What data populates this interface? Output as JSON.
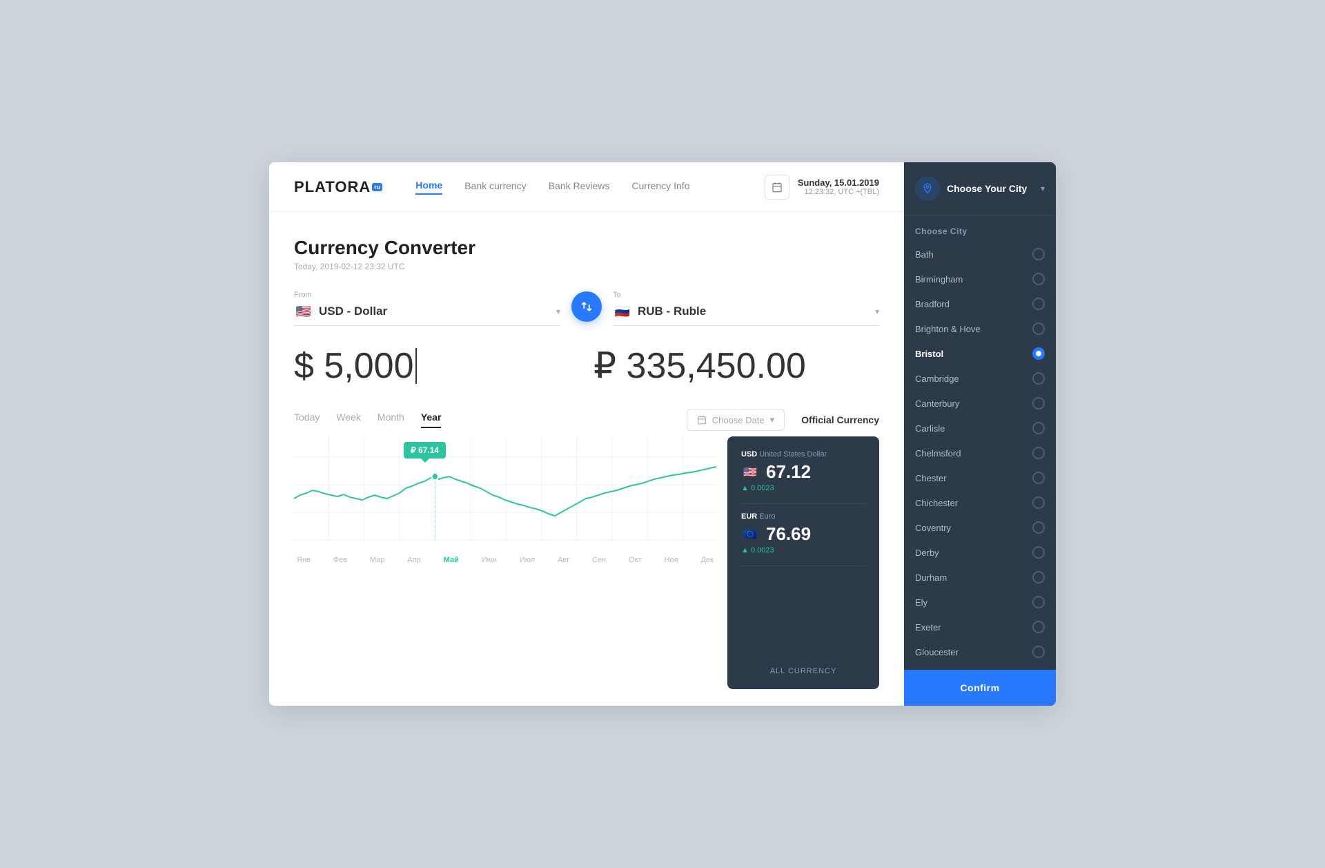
{
  "header": {
    "logo_text": "PLATORA",
    "logo_badge": "ru",
    "nav_items": [
      {
        "label": "Home",
        "active": true
      },
      {
        "label": "Bank currency",
        "active": false
      },
      {
        "label": "Bank Reviews",
        "active": false
      },
      {
        "label": "Currency Info",
        "active": false
      }
    ],
    "date_main": "Sunday, 15.01.2019",
    "date_sub": "12:23:32, UTC +(TBL)"
  },
  "page": {
    "title": "Currency Converter",
    "subtitle": "Today, 2019-02-12 23:32 UTC"
  },
  "converter": {
    "from_label": "From",
    "from_currency": "USD - Dollar",
    "from_flag": "🇺🇸",
    "to_label": "To",
    "to_currency": "RUB - Ruble",
    "to_flag": "🇷🇺",
    "from_amount": "$ 5,000",
    "to_amount": "₽ 335,450.00"
  },
  "time_range": {
    "buttons": [
      "Today",
      "Week",
      "Month",
      "Year"
    ],
    "active": "Year",
    "date_picker_placeholder": "Choose Date"
  },
  "chart": {
    "tooltip": "₽ 67.14",
    "x_labels": [
      "Янв",
      "Фев",
      "Мар",
      "Апр",
      "Май",
      "Июн",
      "Июл",
      "Авг",
      "Сен",
      "Окт",
      "Ноя",
      "Дек"
    ],
    "active_label": "Май"
  },
  "official_currency": {
    "label": "Official Currency",
    "entries": [
      {
        "code": "USD",
        "name": "United States Dollar",
        "value": "67.12",
        "flag": "🇺🇸",
        "change": "▲ 0.0023"
      },
      {
        "code": "EUR",
        "name": "Euro",
        "value": "76.69",
        "flag": "🇪🇺",
        "change": "▲ 0.0023"
      }
    ],
    "all_label": "ALL CURRENCY"
  },
  "sidebar": {
    "header_label": "Choose Your City",
    "section_title": "Choose City",
    "cities": [
      {
        "name": "Bath",
        "selected": false
      },
      {
        "name": "Birmingham",
        "selected": false
      },
      {
        "name": "Bradford",
        "selected": false
      },
      {
        "name": "Brighton & Hove",
        "selected": false
      },
      {
        "name": "Bristol",
        "selected": true
      },
      {
        "name": "Cambridge",
        "selected": false
      },
      {
        "name": "Canterbury",
        "selected": false
      },
      {
        "name": "Carlisle",
        "selected": false
      },
      {
        "name": "Chelmsford",
        "selected": false
      },
      {
        "name": "Chester",
        "selected": false
      },
      {
        "name": "Chichester",
        "selected": false
      },
      {
        "name": "Coventry",
        "selected": false
      },
      {
        "name": "Derby",
        "selected": false
      },
      {
        "name": "Durham",
        "selected": false
      },
      {
        "name": "Ely",
        "selected": false
      },
      {
        "name": "Exeter",
        "selected": false
      },
      {
        "name": "Gloucester",
        "selected": false
      }
    ],
    "confirm_label": "Confirm"
  }
}
